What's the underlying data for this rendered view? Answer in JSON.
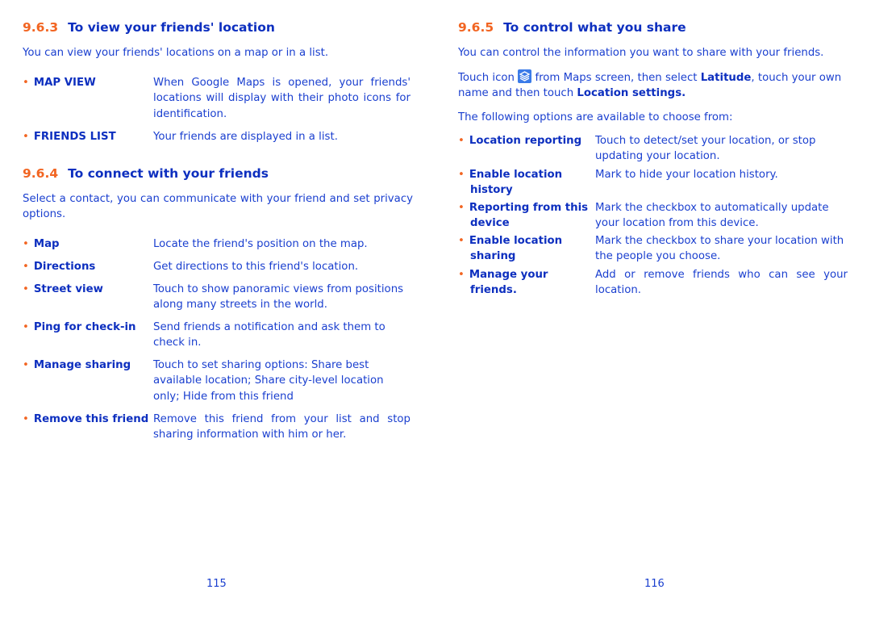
{
  "colors": {
    "accent_orange": "#f26522",
    "heading_blue": "#0d2fbf",
    "text_blue": "#1a3fcf"
  },
  "left_page": {
    "page_number": "115",
    "section_963": {
      "number": "9.6.3",
      "title": "To view your friends' location",
      "intro": "You can view your friends' locations on a map or in a list.",
      "items": [
        {
          "term": "MAP VIEW",
          "desc": "When Google Maps is opened, your friends' locations will display with their photo icons for identification."
        },
        {
          "term": "FRIENDS LIST",
          "desc": "Your friends are displayed in a list."
        }
      ]
    },
    "section_964": {
      "number": "9.6.4",
      "title": "To connect with your friends",
      "intro": "Select a contact, you can communicate with your friend and set privacy options.",
      "items": [
        {
          "term": "Map",
          "desc": "Locate the friend's position on the map."
        },
        {
          "term": "Directions",
          "desc": "Get directions to this friend's location."
        },
        {
          "term": "Street view",
          "desc": "Touch to show panoramic views from positions along many streets in the world."
        },
        {
          "term": "Ping for check-in",
          "desc": "Send friends a notification and ask them to check in."
        },
        {
          "term": "Manage sharing",
          "desc": "Touch to set sharing options: Share best available location; Share city-level location only; Hide from this friend"
        },
        {
          "term": "Remove this friend",
          "desc": "Remove this friend from your list and stop sharing information with him or her."
        }
      ]
    }
  },
  "right_page": {
    "page_number": "116",
    "section_965": {
      "number": "9.6.5",
      "title": "To control what you share",
      "intro": "You can control the information you want to share with your friends.",
      "touch_line": {
        "part1": "Touch icon",
        "icon": "latitude-layers-icon",
        "part2": "from Maps screen, then select",
        "bold1": "Latitude",
        "part3": ", touch your own name and then touch",
        "bold2": "Location settings."
      },
      "options_intro": "The following options are available to choose from:",
      "items": [
        {
          "term": "Location reporting",
          "desc": "Touch to detect/set your location, or stop updating your location."
        },
        {
          "term": "Enable location history",
          "desc": "Mark to hide your location history."
        },
        {
          "term": "Reporting from this device",
          "desc": "Mark the checkbox to automatically update your location from this device."
        },
        {
          "term": "Enable location sharing",
          "desc": "Mark the checkbox to share your location with the people you choose."
        },
        {
          "term": "Manage your friends.",
          "desc": "Add or remove friends who can see your location."
        }
      ]
    }
  }
}
